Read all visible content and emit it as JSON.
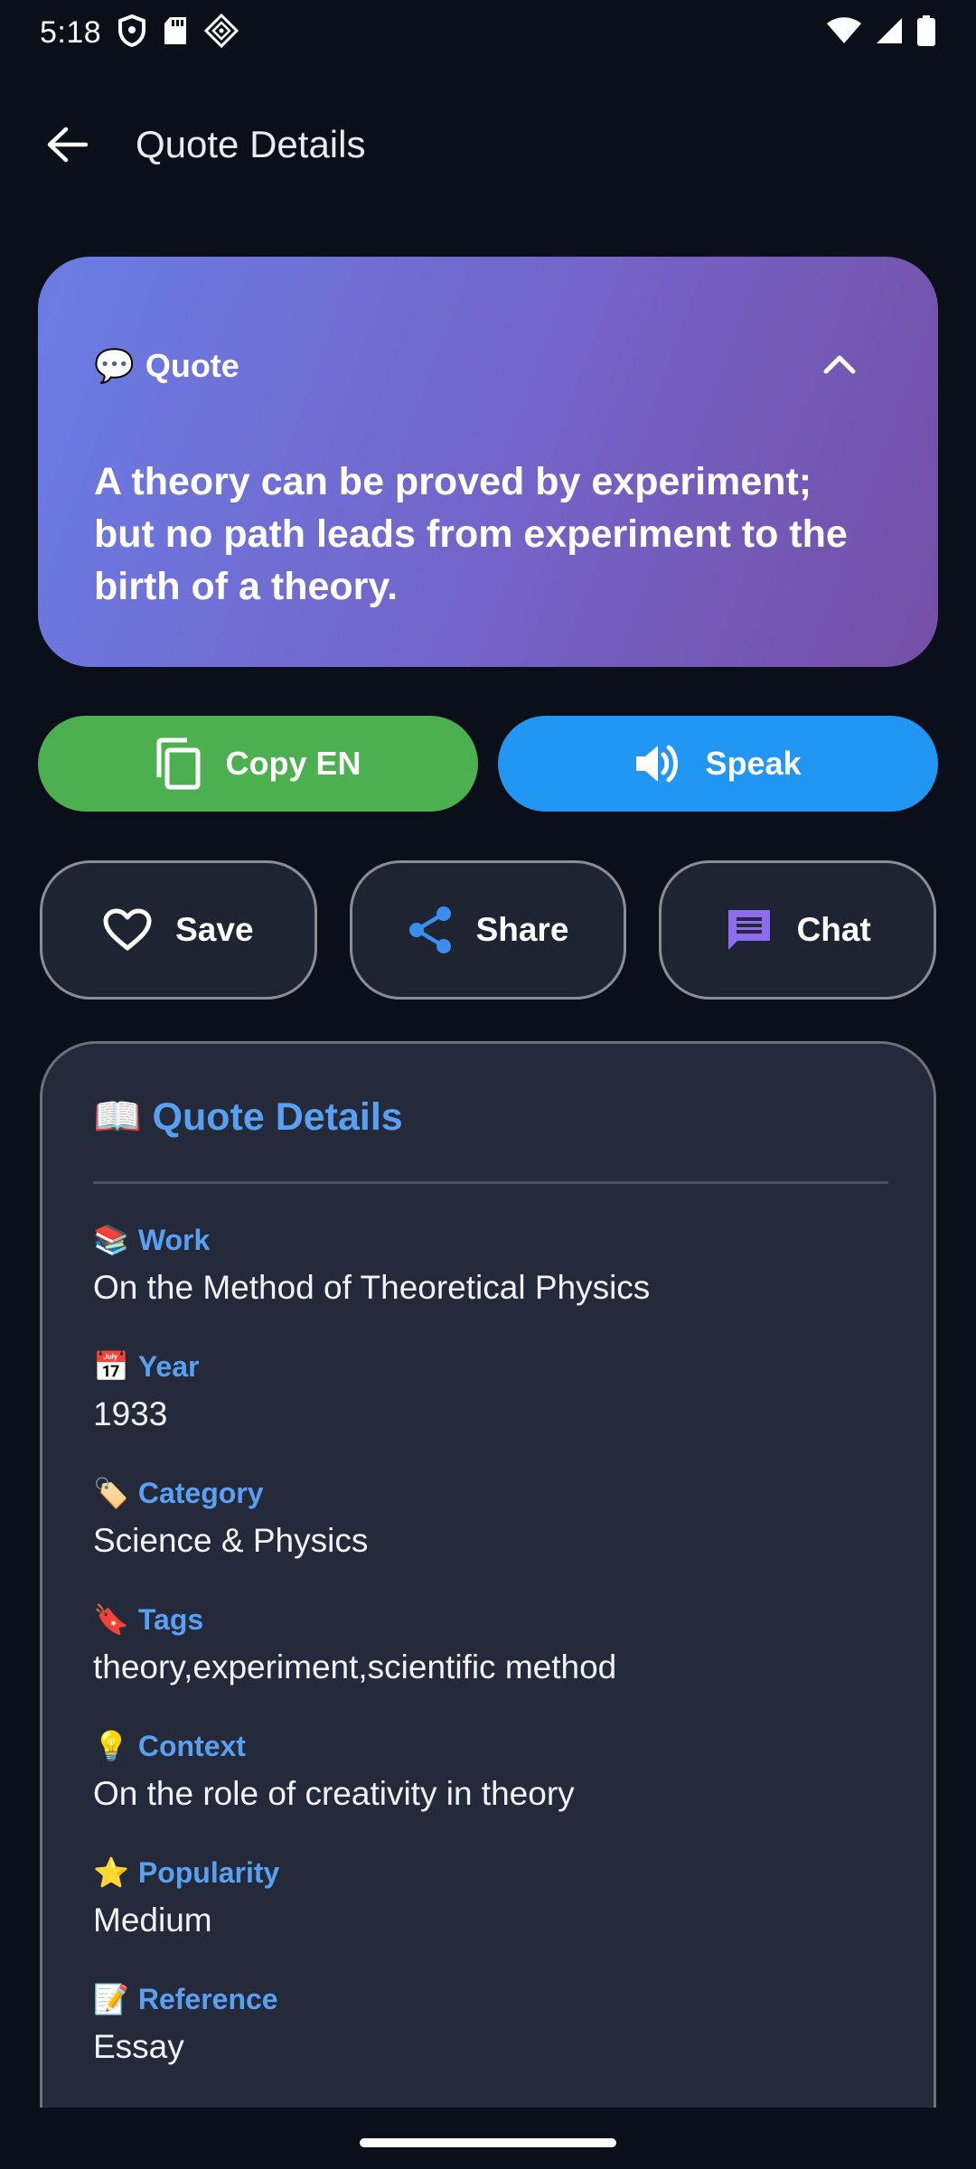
{
  "status_bar": {
    "time": "5:18"
  },
  "app_bar": {
    "title": "Quote Details"
  },
  "quote_card": {
    "label": "Quote",
    "label_emoji": "💬",
    "text": "A theory can be proved by experiment; but no path leads from experiment to the birth of a theory."
  },
  "actions": {
    "copy_label": "Copy EN",
    "speak_label": "Speak",
    "save_label": "Save",
    "share_label": "Share",
    "chat_label": "Chat"
  },
  "details": {
    "title_emoji": "📖",
    "title": "Quote Details",
    "items": [
      {
        "emoji": "📚",
        "label": "Work",
        "value": "On the Method of Theoretical Physics"
      },
      {
        "emoji": "📅",
        "label": "Year",
        "value": "1933"
      },
      {
        "emoji": "🏷️",
        "label": "Category",
        "value": "Science & Physics"
      },
      {
        "emoji": "🔖",
        "label": "Tags",
        "value": "theory,experiment,scientific method"
      },
      {
        "emoji": "💡",
        "label": "Context",
        "value": "On the role of creativity in theory"
      },
      {
        "emoji": "⭐",
        "label": "Popularity",
        "value": "Medium"
      },
      {
        "emoji": "📝",
        "label": "Reference",
        "value": "Essay"
      }
    ]
  },
  "colors": {
    "background": "#0b0f1a",
    "copy_green": "#4caf50",
    "speak_blue": "#2196f3",
    "accent_label": "#5aa0f2",
    "chat_icon": "#8e6cf0"
  }
}
